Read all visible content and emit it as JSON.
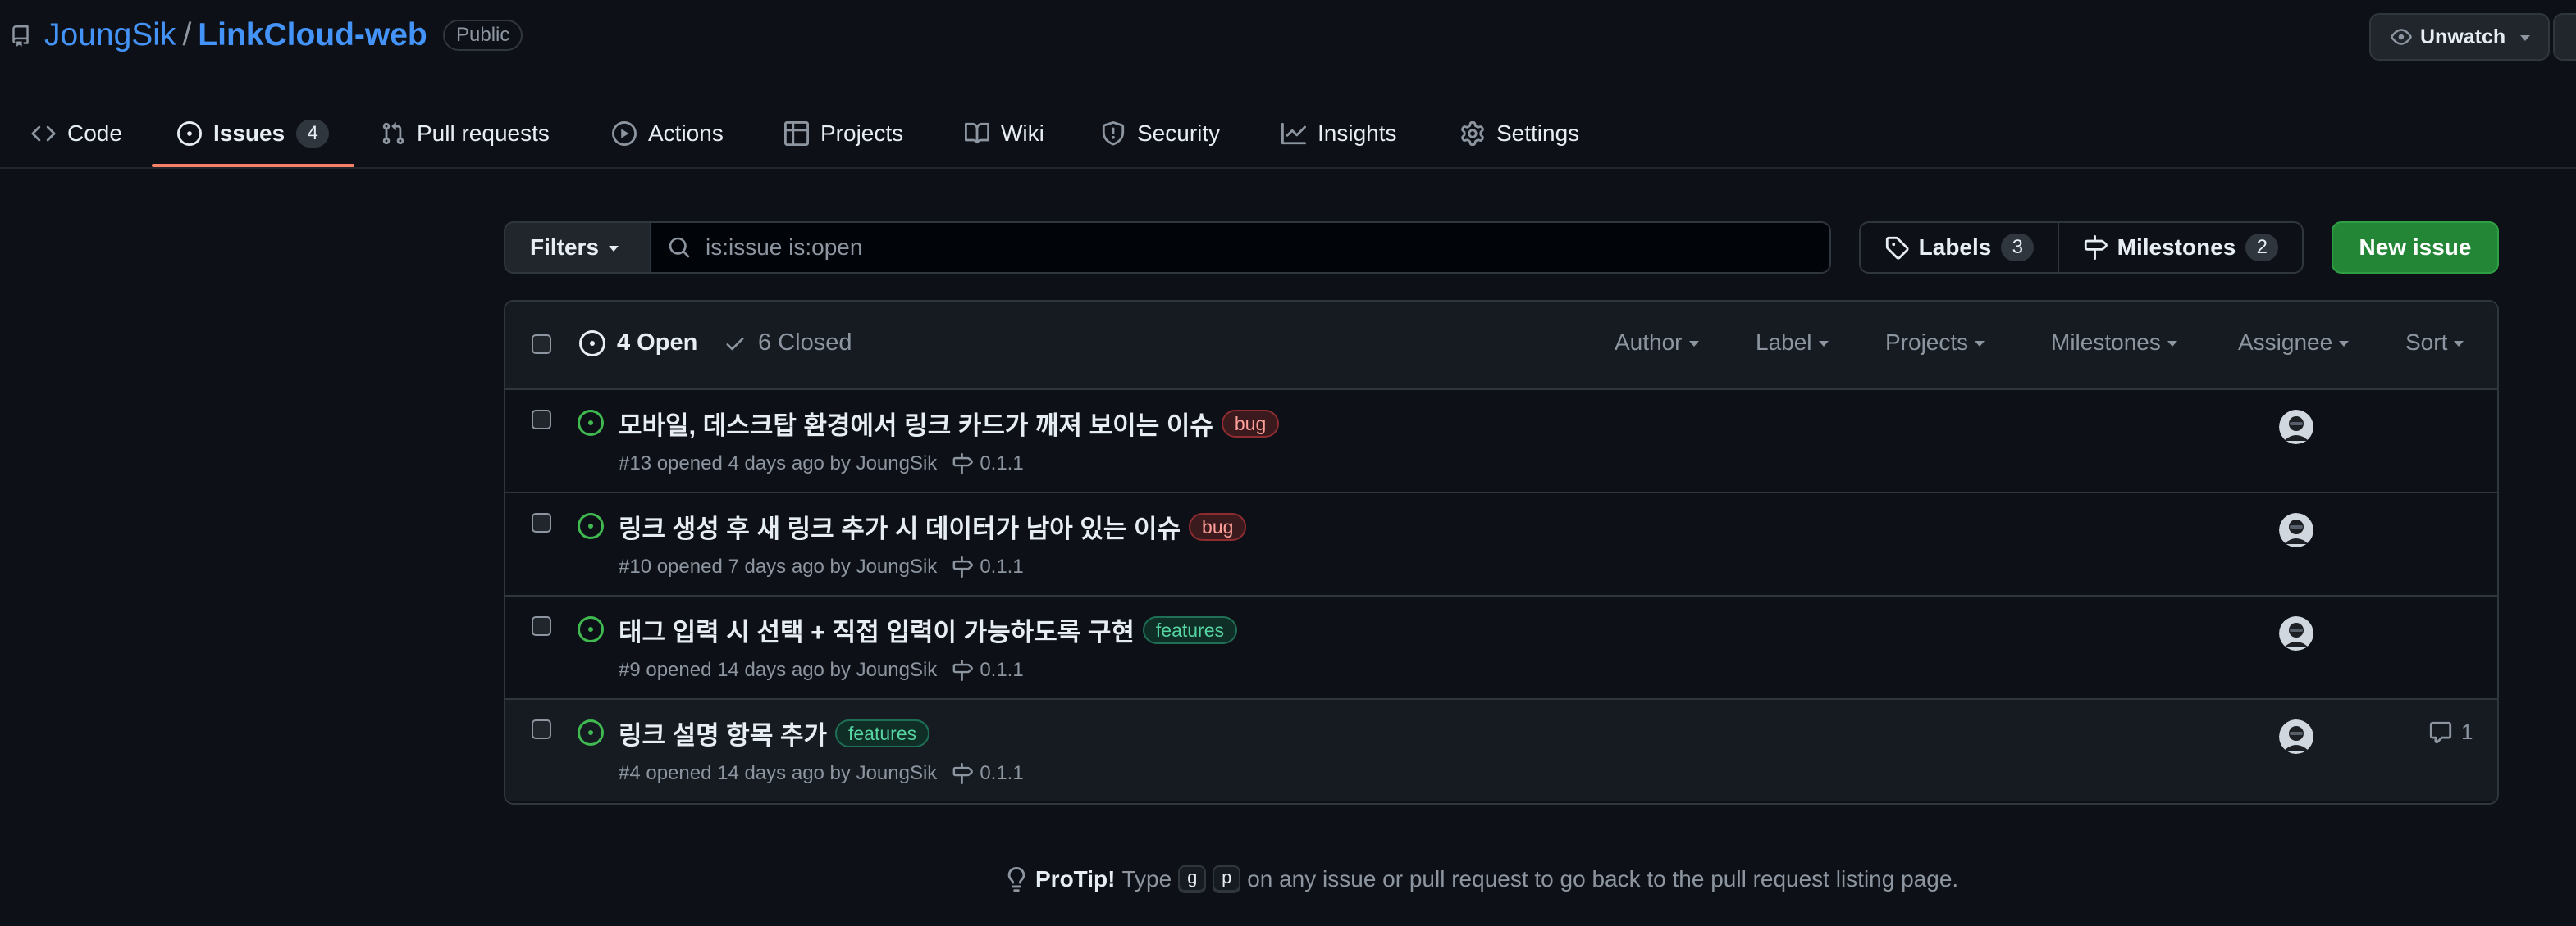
{
  "repo": {
    "owner": "JoungSik",
    "separator": "/",
    "name": "LinkCloud-web",
    "visibility": "Public",
    "watch_label": "Unwatch"
  },
  "tabs": [
    {
      "label": "Code",
      "icon": "code-icon"
    },
    {
      "label": "Issues",
      "icon": "issue-opened-icon",
      "count": "4",
      "active": true
    },
    {
      "label": "Pull requests",
      "icon": "git-pull-request-icon"
    },
    {
      "label": "Actions",
      "icon": "play-icon"
    },
    {
      "label": "Projects",
      "icon": "table-icon"
    },
    {
      "label": "Wiki",
      "icon": "book-icon"
    },
    {
      "label": "Security",
      "icon": "shield-icon"
    },
    {
      "label": "Insights",
      "icon": "graph-icon"
    },
    {
      "label": "Settings",
      "icon": "gear-icon"
    }
  ],
  "toolbar": {
    "filters_label": "Filters",
    "search_value": "is:issue is:open",
    "labels_label": "Labels",
    "labels_count": "3",
    "milestones_label": "Milestones",
    "milestones_count": "2",
    "new_issue_label": "New issue"
  },
  "list_header": {
    "open_label": "4 Open",
    "closed_label": "6 Closed",
    "filters": [
      "Author",
      "Label",
      "Projects",
      "Milestones",
      "Assignee",
      "Sort"
    ]
  },
  "issues": [
    {
      "title": "모바일, 데스크탑 환경에서 링크 카드가 깨져 보이는 이슈",
      "label": "bug",
      "meta": "#13 opened 4 days ago by JoungSik",
      "milestone": "0.1.1",
      "comments": ""
    },
    {
      "title": "링크 생성 후 새 링크 추가 시 데이터가 남아 있는 이슈",
      "label": "bug",
      "meta": "#10 opened 7 days ago by JoungSik",
      "milestone": "0.1.1",
      "comments": ""
    },
    {
      "title": "태그 입력 시 선택 + 직접 입력이 가능하도록 구현",
      "label": "features",
      "meta": "#9 opened 14 days ago by JoungSik",
      "milestone": "0.1.1",
      "comments": ""
    },
    {
      "title": "링크 설명 항목 추가",
      "label": "features",
      "meta": "#4 opened 14 days ago by JoungSik",
      "milestone": "0.1.1",
      "comments": "1"
    }
  ],
  "protip": {
    "title": "ProTip!",
    "pre": "Type",
    "key1": "g",
    "key2": "p",
    "post": "on any issue or pull request to go back to the pull request listing page."
  },
  "colors": {
    "background": "#0d1117",
    "link": "#4493f8",
    "accent_underline": "#f78166",
    "open_green": "#3fb950",
    "new_issue_green": "#238636",
    "bug_label": "#f85149",
    "features_label": "#56d4a2"
  }
}
